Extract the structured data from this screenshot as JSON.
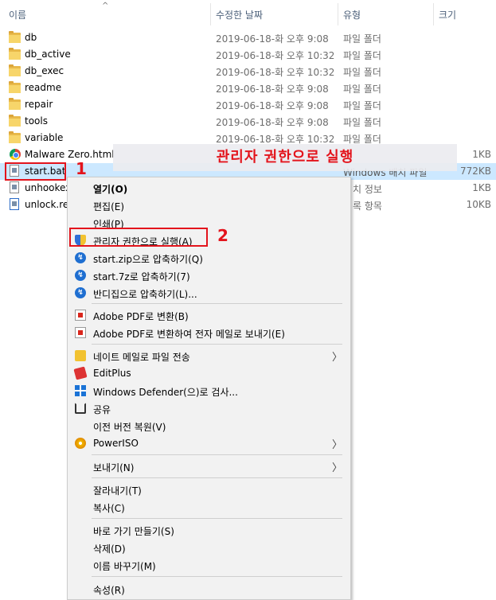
{
  "header": {
    "col_name": "이름",
    "col_date": "수정한 날짜",
    "col_type": "유형",
    "col_size": "크기",
    "sort_arrow": "^"
  },
  "files": [
    {
      "name": "db",
      "date": "2019-06-18-화 오후 9:08",
      "type": "파일 폴더",
      "size": "",
      "icon": "folder-icon"
    },
    {
      "name": "db_active",
      "date": "2019-06-18-화 오후 10:32",
      "type": "파일 폴더",
      "size": "",
      "icon": "folder-icon"
    },
    {
      "name": "db_exec",
      "date": "2019-06-18-화 오후 10:32",
      "type": "파일 폴더",
      "size": "",
      "icon": "folder-icon"
    },
    {
      "name": "readme",
      "date": "2019-06-18-화 오후 9:08",
      "type": "파일 폴더",
      "size": "",
      "icon": "folder-icon"
    },
    {
      "name": "repair",
      "date": "2019-06-18-화 오후 9:08",
      "type": "파일 폴더",
      "size": "",
      "icon": "folder-icon"
    },
    {
      "name": "tools",
      "date": "2019-06-18-화 오후 9:08",
      "type": "파일 폴더",
      "size": "",
      "icon": "folder-icon"
    },
    {
      "name": "variable",
      "date": "2019-06-18-화 오후 10:32",
      "type": "파일 폴더",
      "size": "",
      "icon": "folder-icon"
    },
    {
      "name": "Malware Zero.html",
      "date": "",
      "type": "",
      "size": "1KB",
      "icon": "chrome-icon"
    },
    {
      "name": "start.bat",
      "date": "",
      "type": "Windows 배치 파일",
      "size": "772KB",
      "icon": "batch-file-icon"
    },
    {
      "name": "unhookex",
      "date": "",
      "type": "치 정보",
      "size": "1KB",
      "icon": "document-icon"
    },
    {
      "name": "unlock.reg",
      "date": "",
      "type": "록 항목",
      "size": "10KB",
      "icon": "registry-icon"
    }
  ],
  "banner": {
    "text": "관리자 권한으로 실행"
  },
  "callouts": {
    "one": "1",
    "two": "2"
  },
  "menu": {
    "open": "열기(O)",
    "edit": "편집(E)",
    "print": "인쇄(P)",
    "run_as_admin": "관리자 권한으로 실행(A)",
    "zip": "start.zip으로 압축하기(Q)",
    "sevenz": "start.7z로 압축하기(7)",
    "bandizip": "반디집으로 압축하기(L)...",
    "pdf_convert": "Adobe PDF로 변환(B)",
    "pdf_email": "Adobe PDF로 변환하여 전자 메일로 보내기(E)",
    "naver_mail": "네이트 메일로 파일 전송",
    "editplus": "EditPlus",
    "defender": "Windows Defender(으)로 검사...",
    "share": "공유",
    "restore": "이전 버전 복원(V)",
    "poweriso": "PowerISO",
    "send_to": "보내기(N)",
    "cut": "잘라내기(T)",
    "copy": "복사(C)",
    "shortcut": "바로 가기 만들기(S)",
    "delete": "삭제(D)",
    "rename": "이름 바꾸기(M)",
    "properties": "속성(R)",
    "submenu_arrow": "〉"
  },
  "colors": {
    "highlight": "#cce8ff",
    "callout_red": "#e3141c",
    "menu_bg": "#f2f2f2"
  }
}
